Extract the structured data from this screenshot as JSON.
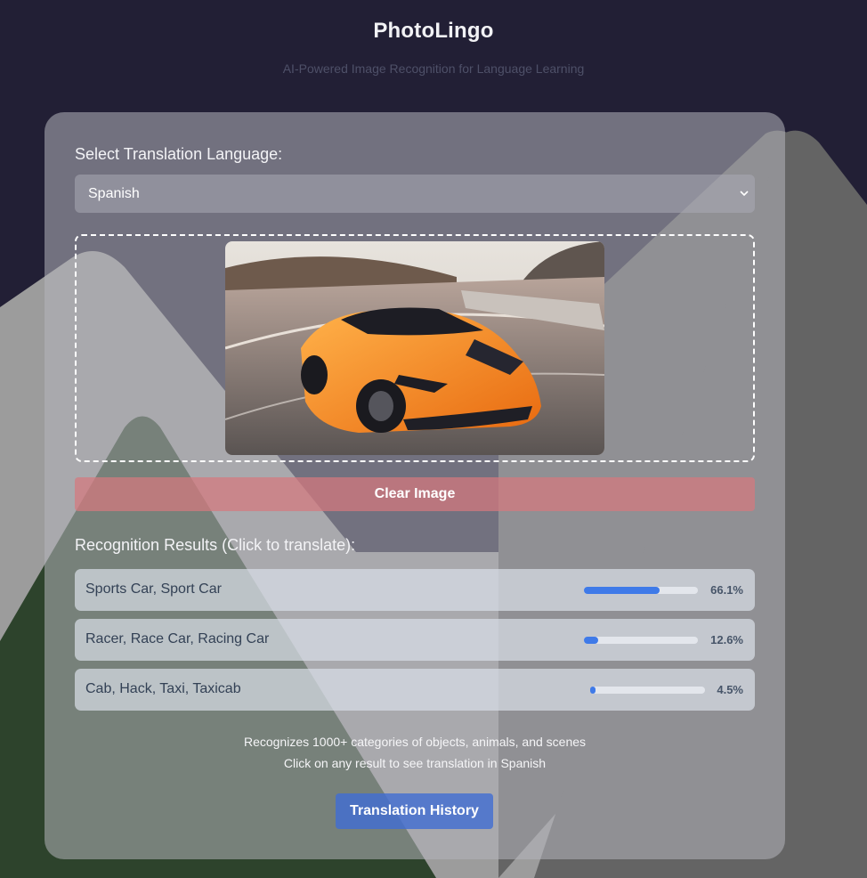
{
  "header": {
    "title": "PhotoLingo",
    "subtitle": "AI-Powered Image Recognition for Language Learning"
  },
  "language": {
    "label": "Select Translation Language:",
    "selected": "Spanish"
  },
  "clear_button": "Clear Image",
  "results": {
    "heading": "Recognition Results (Click to translate):",
    "items": [
      {
        "label": "Sports Car, Sport Car",
        "confidence": 0.661,
        "percent_text": "66.1%"
      },
      {
        "label": "Racer, Race Car, Racing Car",
        "confidence": 0.126,
        "percent_text": "12.6%"
      },
      {
        "label": "Cab, Hack, Taxi, Taxicab",
        "confidence": 0.045,
        "percent_text": "4.5%"
      }
    ]
  },
  "footer": {
    "line1": "Recognizes 1000+ categories of objects, animals, and scenes",
    "line2": "Click on any result to see translation in Spanish"
  },
  "history_button": "Translation History",
  "colors": {
    "background": "#221f35",
    "accent_blue": "#3f7ae8",
    "clear_red": "#d6787e"
  }
}
